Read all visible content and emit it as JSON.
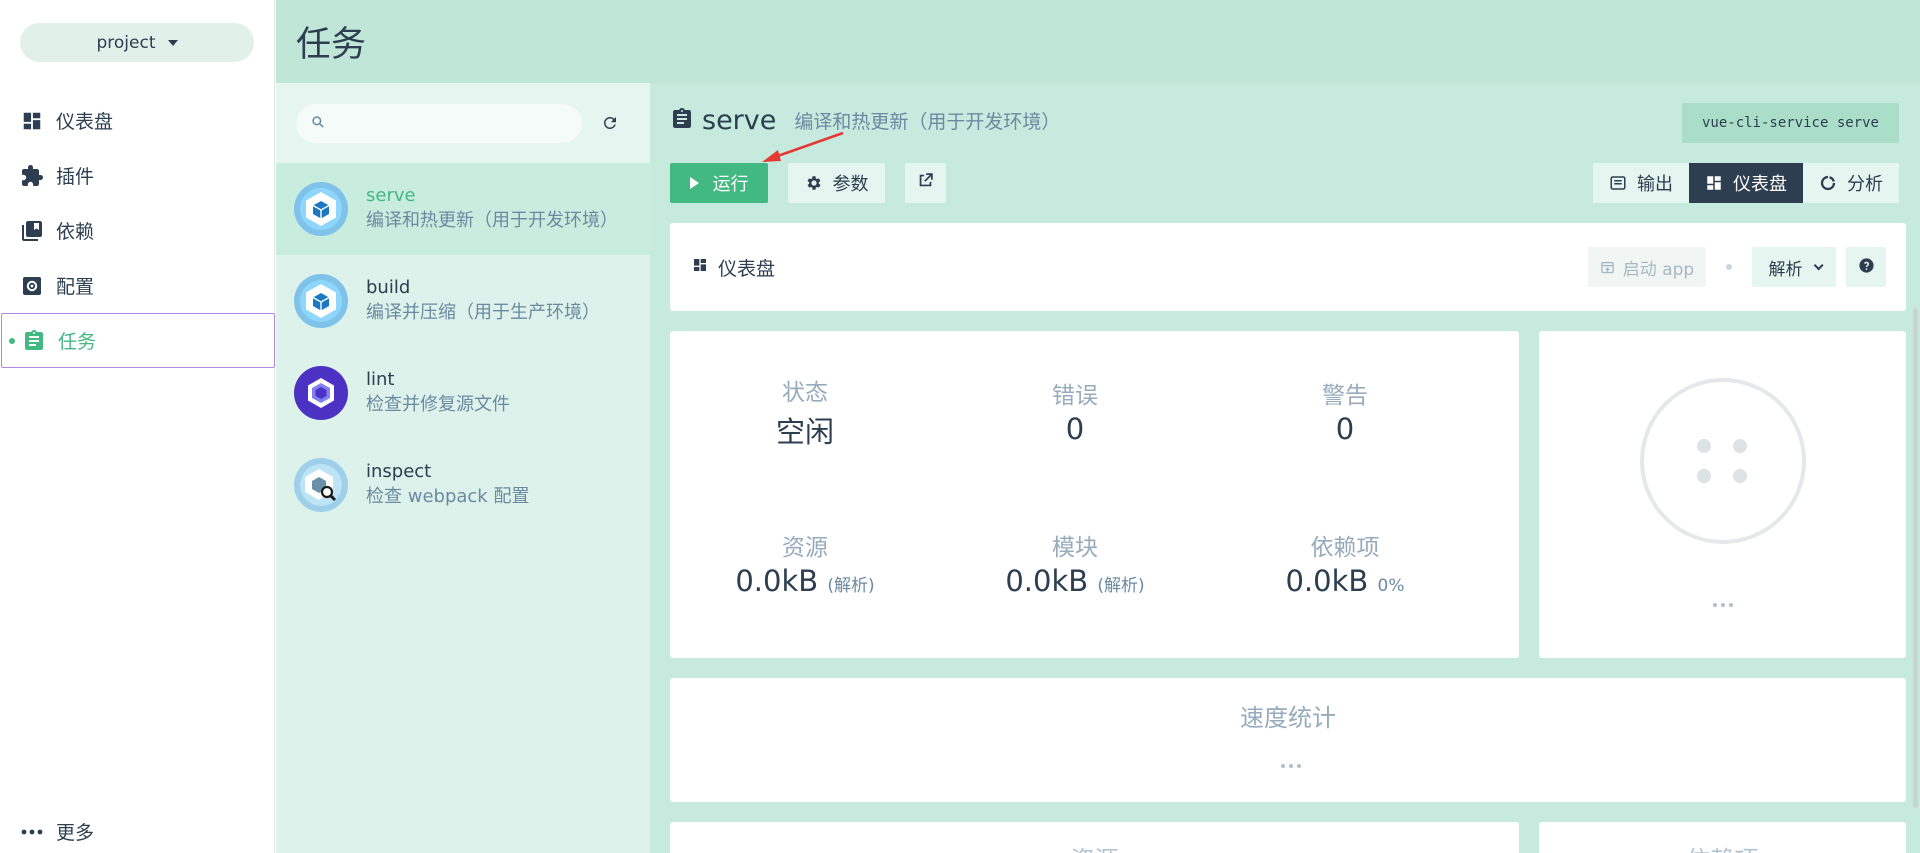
{
  "nav": {
    "project": "project",
    "items": [
      {
        "label": "仪表盘",
        "icon": "dashboard-icon"
      },
      {
        "label": "插件",
        "icon": "puzzle-icon"
      },
      {
        "label": "依赖",
        "icon": "library-icon"
      },
      {
        "label": "配置",
        "icon": "settings-icon"
      },
      {
        "label": "任务",
        "icon": "assignment-icon",
        "active": true
      }
    ],
    "more": "更多"
  },
  "header": {
    "title": "任务"
  },
  "tasks": {
    "search_placeholder": "",
    "items": [
      {
        "name": "serve",
        "desc": "编译和热更新（用于开发环境）",
        "selected": true
      },
      {
        "name": "build",
        "desc": "编译并压缩（用于生产环境）"
      },
      {
        "name": "lint",
        "desc": "检查并修复源文件"
      },
      {
        "name": "inspect",
        "desc": "检查 webpack 配置"
      }
    ]
  },
  "detail": {
    "name": "serve",
    "desc": "编译和热更新（用于开发环境）",
    "command": "vue-cli-service serve",
    "run_label": "运行",
    "params_label": "参数",
    "views": {
      "output": "输出",
      "dashboard": "仪表盘",
      "analyze": "分析"
    },
    "dashboard": {
      "label": "仪表盘",
      "open_app": "启动 app",
      "parse_select": "解析"
    },
    "stats": {
      "status": {
        "label": "状态",
        "value": "空闲"
      },
      "errors": {
        "label": "错误",
        "value": "0"
      },
      "warnings": {
        "label": "警告",
        "value": "0"
      },
      "assets": {
        "label": "资源",
        "value": "0.0kB",
        "note": "(解析)"
      },
      "modules": {
        "label": "模块",
        "value": "0.0kB",
        "note": "(解析)"
      },
      "deps": {
        "label": "依赖项",
        "value": "0.0kB",
        "note": "0%"
      }
    },
    "speed_title": "速度统计",
    "bottom_left_title": "资源",
    "bottom_right_title": "依赖项"
  },
  "colors": {
    "accent": "#42b983",
    "header_bg": "#bfe6d7",
    "main_bg": "#c6ebde",
    "dark": "#2c3e50"
  }
}
